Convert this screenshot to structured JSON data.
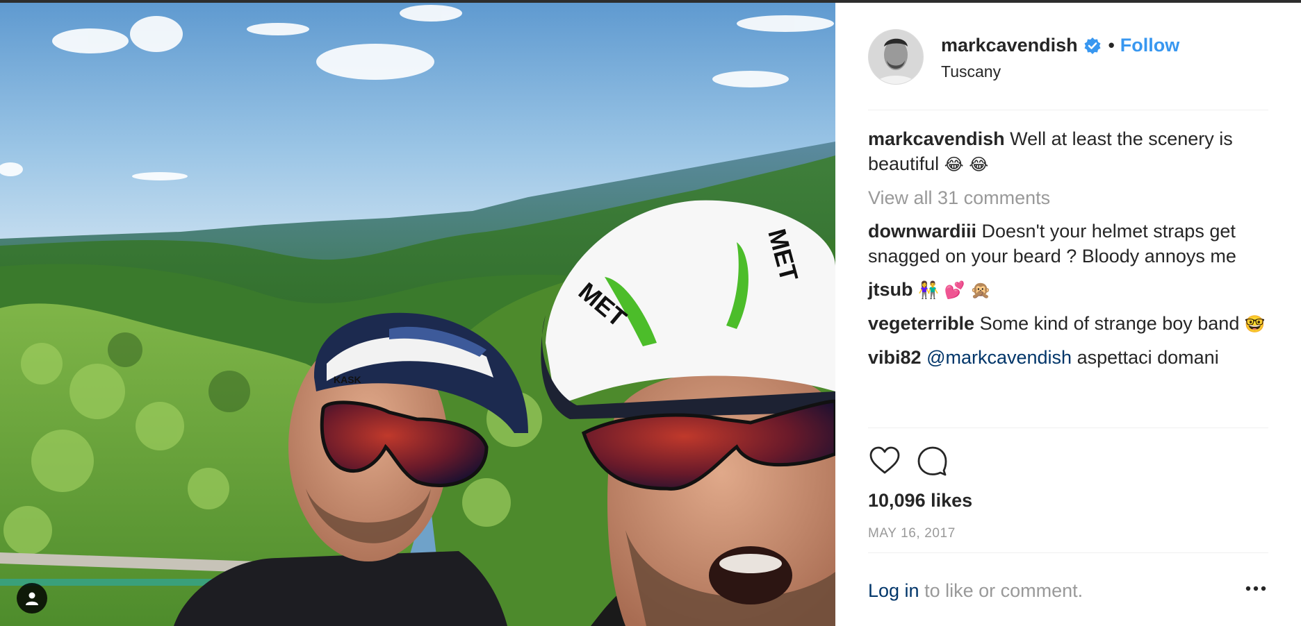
{
  "post": {
    "username": "markcavendish",
    "verified": true,
    "separator": "•",
    "follow_label": "Follow",
    "location": "Tuscany"
  },
  "caption": {
    "username": "markcavendish",
    "text": "Well at least the scenery is beautiful",
    "emoji": "😂 😂"
  },
  "view_all_comments": "View all 31 comments",
  "comments": [
    {
      "username": "downwardiii",
      "text": "Doesn't your helmet straps get snagged on your beard ? Bloody annoys me",
      "emoji": ""
    },
    {
      "username": "jtsub",
      "text": "",
      "emoji": "👫 💕 🙊"
    },
    {
      "username": "vegeterrible",
      "text": "Some kind of strange boy band",
      "emoji": "🤓"
    },
    {
      "username": "vibi82",
      "mention": "@markcavendish",
      "text": "aspettaci domani"
    }
  ],
  "likes": "10,096 likes",
  "date": "MAY 16, 2017",
  "login": {
    "link": "Log in",
    "rest": "to like or comment."
  },
  "helmet_text": {
    "left": "KASK",
    "right": "MET"
  },
  "icons": {
    "verified": "verified-badge-icon",
    "like": "heart-icon",
    "comment": "comment-bubble-icon",
    "more": "more-options-icon",
    "user_tag": "user-tag-icon"
  },
  "colors": {
    "link_blue": "#3897f0",
    "mention_blue": "#003569",
    "muted": "#999999",
    "text": "#262626"
  }
}
